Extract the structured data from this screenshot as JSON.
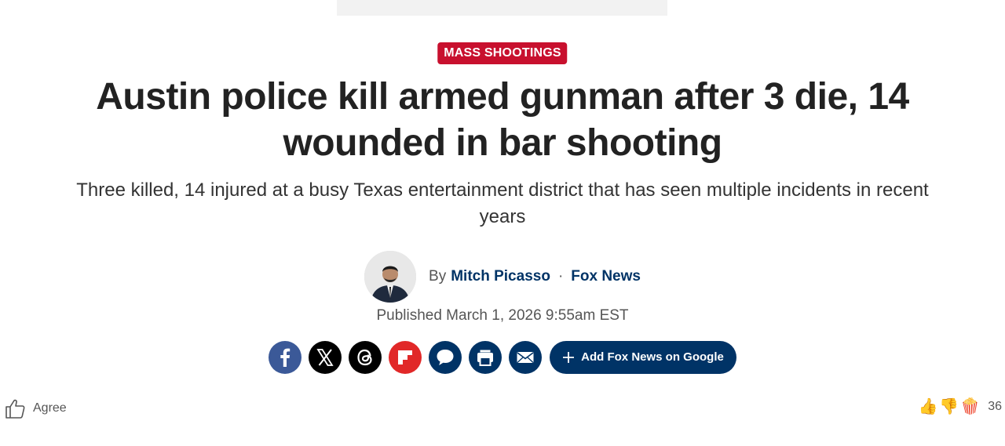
{
  "article": {
    "category": "MASS SHOOTINGS",
    "headline": "Austin police kill armed gunman after 3 die, 14 wounded in bar shooting",
    "subheadline": "Three killed, 14 injured at a busy Texas entertainment district that has seen multiple incidents in recent years",
    "byline": {
      "prefix": "By",
      "author": "Mitch Picasso",
      "separator": "·",
      "outlet": "Fox News"
    },
    "published": "Published March 1, 2026 9:55am EST"
  },
  "share": {
    "buttons": [
      {
        "name": "facebook",
        "icon": "facebook-icon",
        "color": "#3b5998"
      },
      {
        "name": "x",
        "icon": "x-icon",
        "color": "#000000"
      },
      {
        "name": "threads",
        "icon": "threads-icon",
        "color": "#000000"
      },
      {
        "name": "flipboard",
        "icon": "flipboard-icon",
        "color": "#e12828"
      },
      {
        "name": "comments",
        "icon": "comment-icon",
        "color": "#003366"
      },
      {
        "name": "print",
        "icon": "print-icon",
        "color": "#003366"
      },
      {
        "name": "email",
        "icon": "email-icon",
        "color": "#003366"
      }
    ],
    "google_label": "Add Fox News on Google"
  },
  "engagement": {
    "agree_label": "Agree",
    "reaction_count": "36",
    "reactions": [
      "👍",
      "👎",
      "🍿"
    ]
  },
  "colors": {
    "brand": "#003366",
    "category": "#c8102e"
  }
}
